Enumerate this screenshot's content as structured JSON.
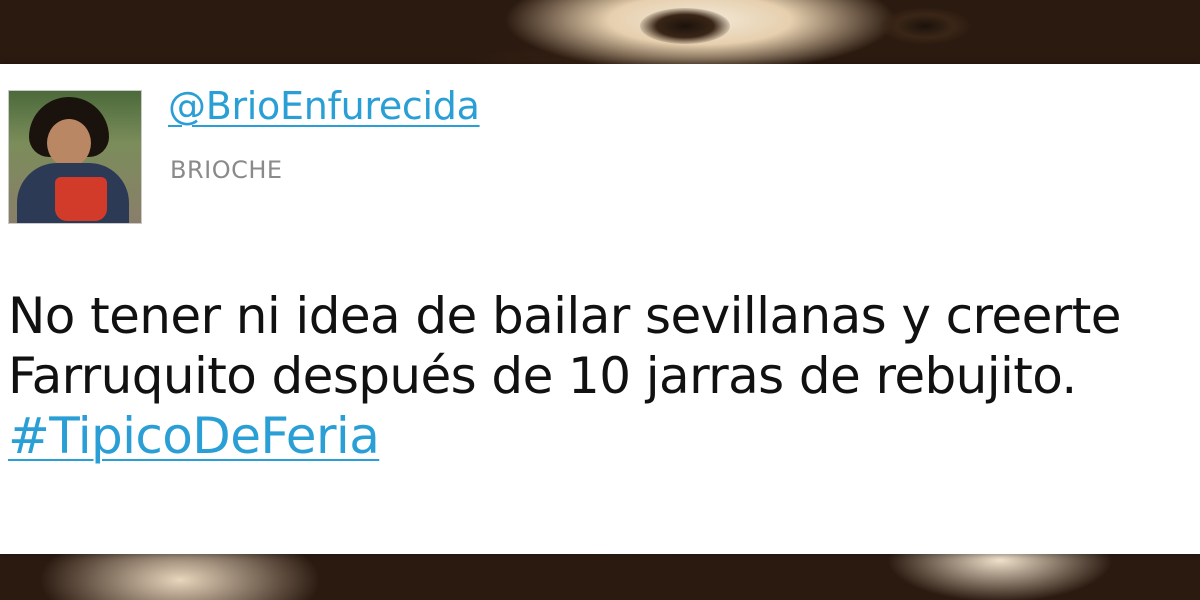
{
  "colors": {
    "link": "#2a9fd6",
    "text": "#111111",
    "muted": "#8a8a8a",
    "card": "#ffffff"
  },
  "tweet": {
    "handle": "@BrioEnfurecida",
    "display_name": "BRIOCHE",
    "avatar_icon": "profile-photo",
    "lines": [
      "No tener ni idea de bailar sevillanas y creerte",
      "Farruquito después de 10 jarras de rebujito."
    ],
    "hashtag": "#TipicoDeFeria"
  }
}
